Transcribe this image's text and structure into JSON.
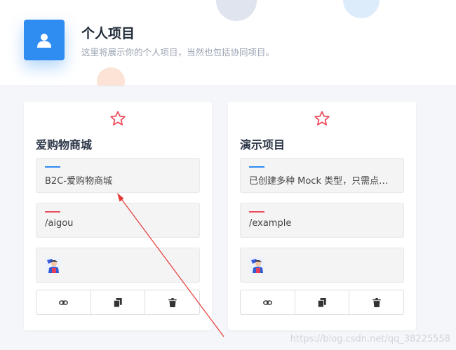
{
  "header": {
    "title": "个人项目",
    "subtitle": "这里将展示你的个人项目，当然也包括协同项目。",
    "icon": "user-icon",
    "accent": "#2f8cf0"
  },
  "projects": [
    {
      "name": "爱购物商城",
      "description": "B2C-爱购物商城",
      "url": "/aigou",
      "actions": [
        "link-icon",
        "copy-icon",
        "trash-icon"
      ]
    },
    {
      "name": "演示项目",
      "description": "已创建多种 Mock 类型，只需点…",
      "url": "/example",
      "actions": [
        "link-icon",
        "copy-icon",
        "trash-icon"
      ]
    }
  ],
  "colors": {
    "star": "#ed4c5e",
    "desc_bar": "#2f8cf0",
    "url_bar": "#ed4c5e",
    "annotation_arrow": "#e53935"
  },
  "watermark": "https://blog.csdn.net/qq_38225558"
}
